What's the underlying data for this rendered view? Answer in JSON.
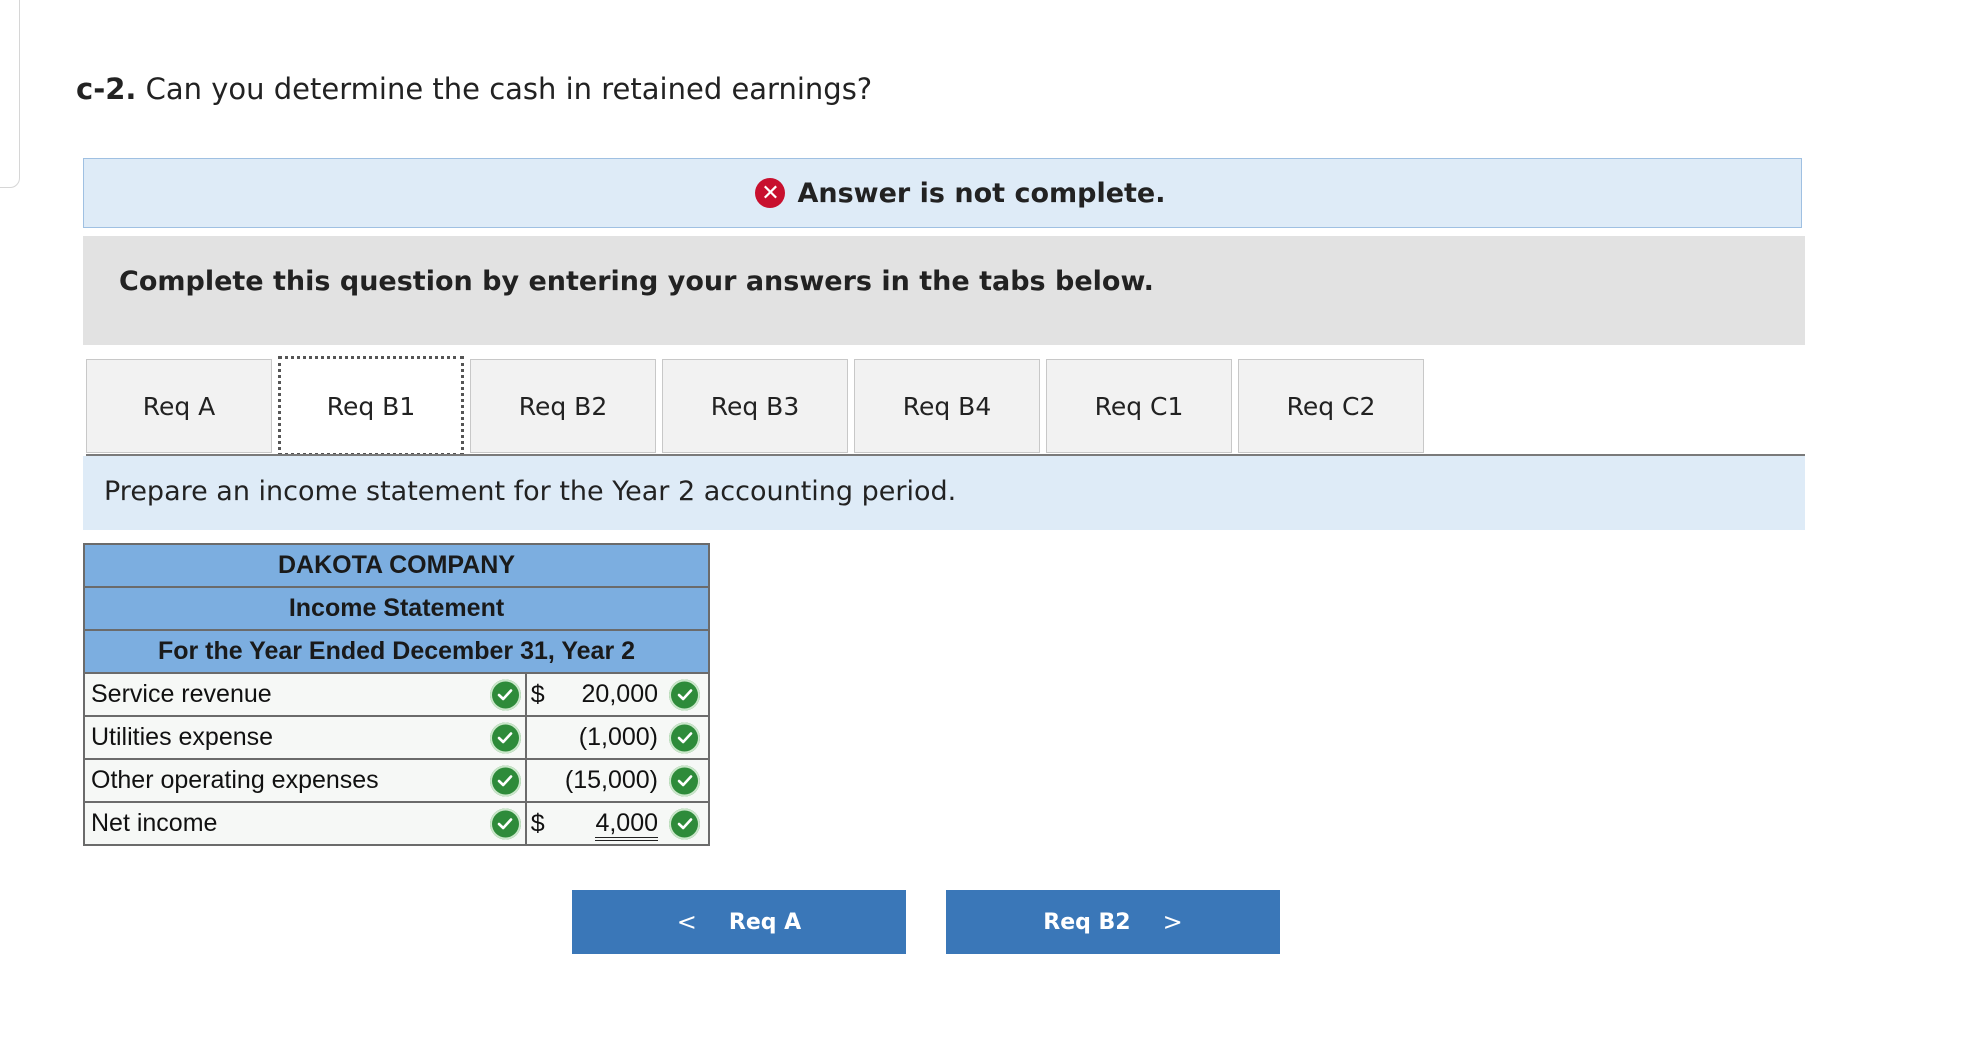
{
  "question": {
    "number": "c-2.",
    "text": " Can you determine the cash in retained earnings?"
  },
  "status": {
    "icon": "x-circle-icon",
    "text": "Answer is not complete."
  },
  "instructions": "Complete this question by entering your answers in the tabs below.",
  "tabs": [
    {
      "label": "Req A"
    },
    {
      "label": "Req B1",
      "active": true
    },
    {
      "label": "Req B2"
    },
    {
      "label": "Req B3"
    },
    {
      "label": "Req B4"
    },
    {
      "label": "Req C1"
    },
    {
      "label": "Req C2"
    }
  ],
  "prompt": "Prepare an income statement for the Year 2 accounting period.",
  "statement": {
    "company": "DAKOTA COMPANY",
    "title": "Income Statement",
    "period": "For the Year Ended December 31, Year 2",
    "rows": [
      {
        "label": "Service revenue",
        "dollar": "$",
        "amount": "20,000"
      },
      {
        "label": "Utilities expense",
        "dollar": "",
        "amount": "(1,000)"
      },
      {
        "label": "Other operating expenses",
        "dollar": "",
        "amount": "(15,000)"
      },
      {
        "label": "Net income",
        "dollar": "$",
        "amount": "4,000"
      }
    ]
  },
  "nav": {
    "prev_label": "Req A",
    "next_label": "Req B2",
    "prev_chevron": "<",
    "next_chevron": ">"
  },
  "colors": {
    "accent": "#3a77b8",
    "banner": "#deebf7",
    "header": "#7caee0",
    "check": "#2e8b3a",
    "error": "#c8102e"
  }
}
